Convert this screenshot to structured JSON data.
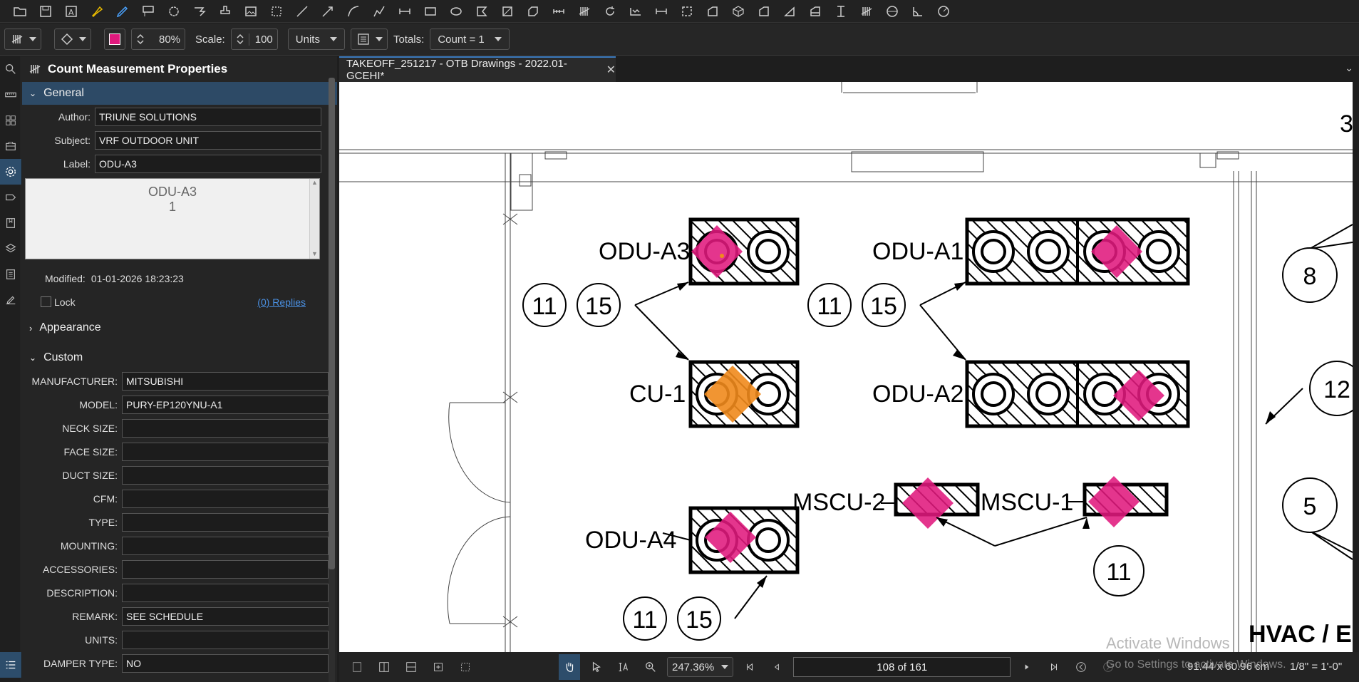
{
  "toolbar2": {
    "zoom_pct": "80%",
    "scale_label": "Scale:",
    "scale_value": "100",
    "units_label": "Units",
    "totals_label": "Totals:",
    "totals_value": "Count = 1",
    "color": "#e0197d"
  },
  "panel": {
    "title": "Count Measurement Properties",
    "general_label": "General",
    "author_label": "Author:",
    "author_value": "TRIUNE SOLUTIONS",
    "subject_label": "Subject:",
    "subject_value": "VRF OUTDOOR UNIT",
    "label_label": "Label:",
    "label_value": "ODU-A3",
    "preview_line1": "ODU-A3",
    "preview_line2": "1",
    "modified_label": "Modified:",
    "modified_value": "01-01-2026 18:23:23",
    "lock_label": "Lock",
    "replies_label": "(0) Replies",
    "appearance_label": "Appearance",
    "custom_label": "Custom",
    "custom_fields": [
      {
        "label": "MANUFACTURER:",
        "value": "MITSUBISHI"
      },
      {
        "label": "MODEL:",
        "value": "PURY-EP120YNU-A1"
      },
      {
        "label": "NECK SIZE:",
        "value": ""
      },
      {
        "label": "FACE SIZE:",
        "value": ""
      },
      {
        "label": "DUCT SIZE:",
        "value": ""
      },
      {
        "label": "CFM:",
        "value": ""
      },
      {
        "label": "TYPE:",
        "value": ""
      },
      {
        "label": "MOUNTING:",
        "value": ""
      },
      {
        "label": "ACCESSORIES:",
        "value": ""
      },
      {
        "label": "DESCRIPTION:",
        "value": ""
      },
      {
        "label": "REMARK:",
        "value": "SEE SCHEDULE"
      },
      {
        "label": "UNITS:",
        "value": ""
      },
      {
        "label": "DAMPER TYPE:",
        "value": "NO"
      }
    ]
  },
  "tab": {
    "title": "TAKEOFF_251217 - OTB Drawings - 2022.01-GCEHI*"
  },
  "drawing": {
    "labels": {
      "odu_a3": "ODU-A3",
      "odu_a1": "ODU-A1",
      "odu_a2": "ODU-A2",
      "odu_a4": "ODU-A4",
      "cu_1": "CU-1",
      "mscu_2": "MSCU-2",
      "mscu_1": "MSCU-1",
      "hvac": "HVAC / EL",
      "corner_num": "3"
    },
    "bubbles": [
      "11",
      "15",
      "11",
      "15",
      "11",
      "15",
      "11",
      "8",
      "12",
      "5"
    ],
    "pink": "#e0197d",
    "orange": "#f08a1c"
  },
  "statusbar": {
    "zoom": "247.36%",
    "page": "108 of 161",
    "size": "91.44 x 60.96 cm",
    "scale": "1/8\" = 1'-0\""
  },
  "watermark": {
    "line1": "Activate Windows",
    "line2": "Go to Settings to activate Windows."
  }
}
